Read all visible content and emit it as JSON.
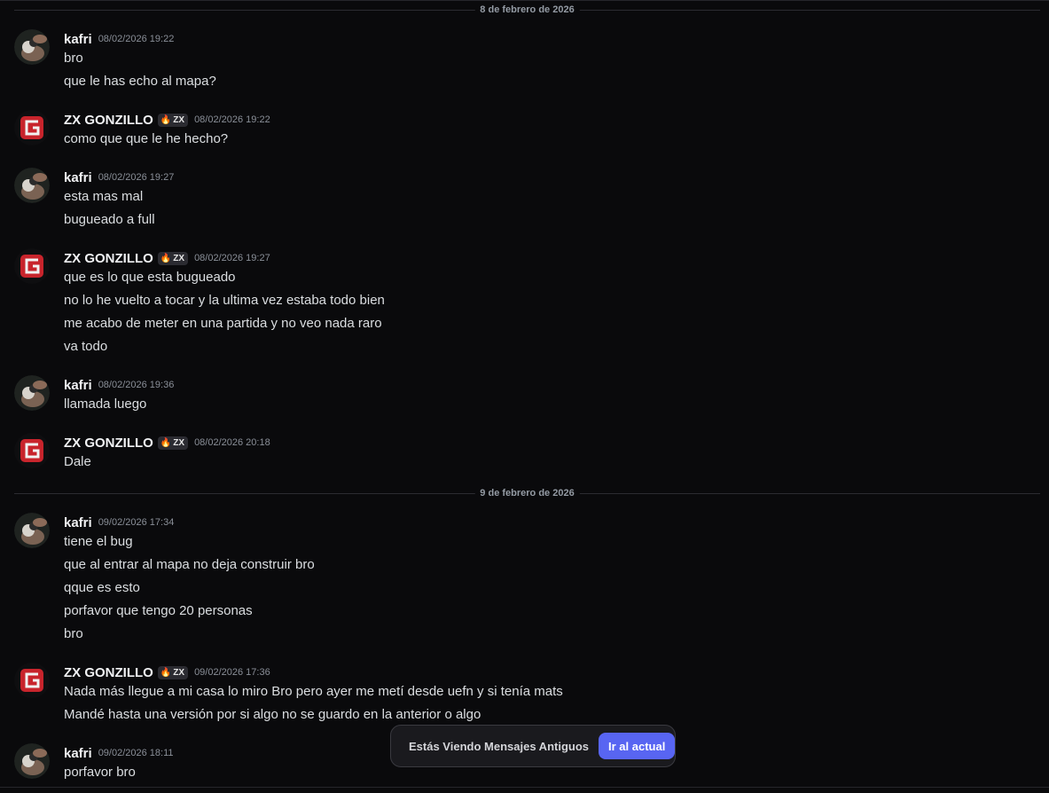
{
  "dividers": [
    "8 de febrero de 2026",
    "9 de febrero de 2026"
  ],
  "users": {
    "kafri": {
      "name": "kafri",
      "avatar_icon": "hand-holding-plush-avatar"
    },
    "gonzillo": {
      "name": "ZX GONZILLO",
      "tag": "ZX",
      "tag_icon": "flame-icon",
      "avatar_icon": "red-g-logo-avatar"
    }
  },
  "messages": [
    {
      "author": "kafri",
      "timestamp": "08/02/2026 19:22",
      "lines": [
        "bro",
        "que le has echo al mapa?"
      ]
    },
    {
      "author": "ZX GONZILLO",
      "timestamp": "08/02/2026 19:22",
      "lines": [
        "como que que le he hecho?"
      ]
    },
    {
      "author": "kafri",
      "timestamp": "08/02/2026 19:27",
      "lines": [
        "esta mas mal",
        "bugueado a full"
      ]
    },
    {
      "author": "ZX GONZILLO",
      "timestamp": "08/02/2026 19:27",
      "lines": [
        "que es lo que esta bugueado",
        "no lo he vuelto a tocar y la ultima vez estaba todo bien",
        "me acabo de meter en una partida y no veo nada raro",
        "va todo"
      ]
    },
    {
      "author": "kafri",
      "timestamp": "08/02/2026 19:36",
      "lines": [
        "llamada luego"
      ]
    },
    {
      "author": "ZX GONZILLO",
      "timestamp": "08/02/2026 20:18",
      "lines": [
        "Dale"
      ]
    },
    {
      "author": "kafri",
      "timestamp": "09/02/2026 17:34",
      "lines": [
        "tiene el bug",
        "que al entrar al mapa no deja construir bro",
        "qque es esto",
        "porfavor que tengo 20 personas",
        "bro"
      ]
    },
    {
      "author": "ZX GONZILLO",
      "timestamp": "09/02/2026 17:36",
      "lines": [
        "Nada más llegue a mi casa lo miro Bro pero ayer me metí desde uefn y si tenía mats",
        "Mandé hasta una versión por si algo no se guardo en la anterior o algo"
      ]
    },
    {
      "author": "kafri",
      "timestamp": "09/02/2026 18:11",
      "lines": [
        "porfavor bro"
      ]
    }
  ],
  "toast": {
    "text": "Estás Viendo Mensajes Antiguos",
    "button": "Ir al actual",
    "button_color": "#5865f2"
  }
}
